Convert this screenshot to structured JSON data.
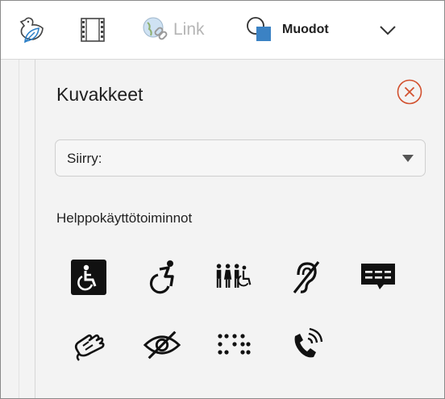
{
  "toolbar": {
    "items": [
      {
        "name": "icons-button",
        "icon": "bird-leaf-icon"
      },
      {
        "name": "video-button",
        "icon": "film-icon"
      },
      {
        "name": "link-button",
        "icon": "globe-link-icon",
        "label": "Link"
      },
      {
        "name": "shapes-button",
        "icon": "shapes-icon",
        "label": "Muodot"
      },
      {
        "name": "more-button",
        "icon": "chevron-down-icon"
      }
    ],
    "link_label": "Link",
    "shapes_label": "Muodot"
  },
  "panel": {
    "title": "Kuvakkeet",
    "close_icon": "close-circle-icon",
    "dropdown": {
      "label": "Siirry:"
    },
    "section_title": "Helppokäyttötoiminnot",
    "icons": [
      "wheelchair-sign-icon",
      "active-wheelchair-icon",
      "accessible-restroom-icon",
      "hearing-impaired-icon",
      "closed-captions-icon",
      "sign-language-icon",
      "vision-impaired-icon",
      "braille-icon",
      "volume-phone-icon"
    ]
  },
  "colors": {
    "accent_close": "#d2512f",
    "shape_blue": "#3b82c4"
  }
}
